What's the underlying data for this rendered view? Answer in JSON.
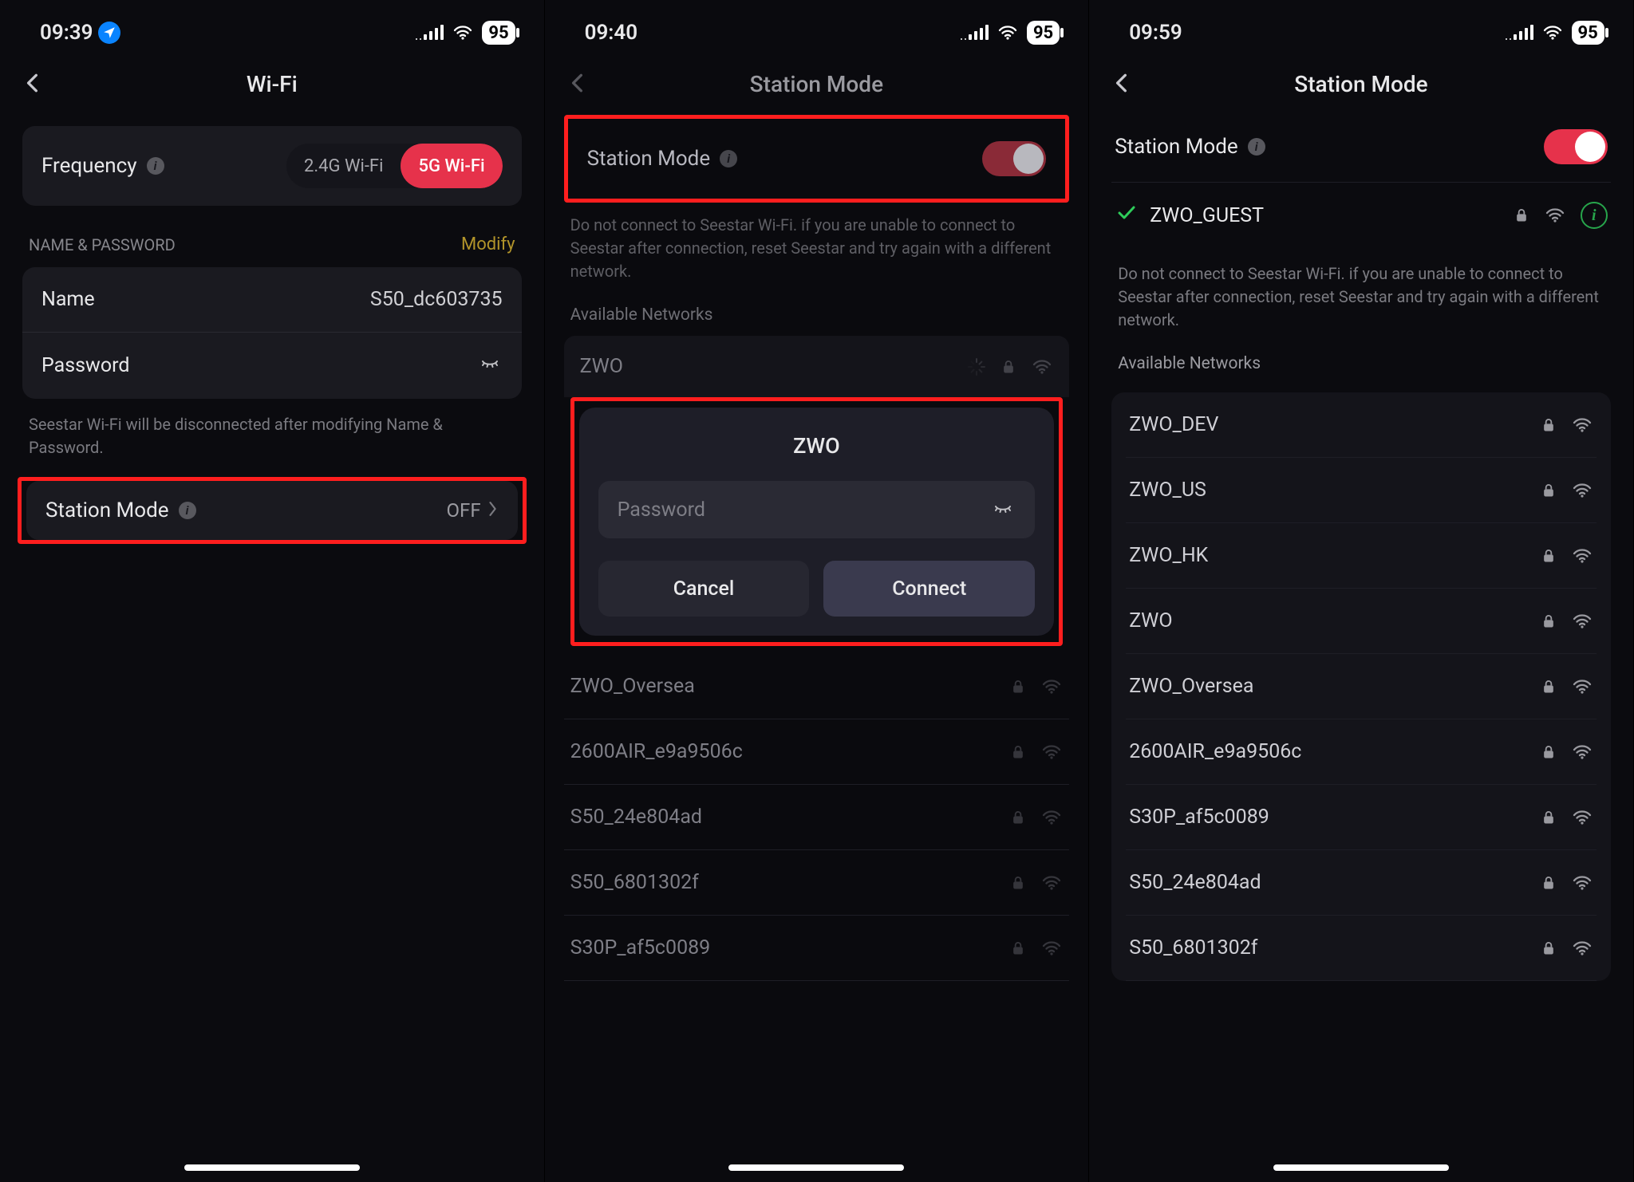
{
  "panel1": {
    "status": {
      "time": "09:39",
      "battery": "95"
    },
    "title": "Wi-Fi",
    "frequency": {
      "label": "Frequency",
      "option_a": "2.4G Wi-Fi",
      "option_b": "5G Wi-Fi"
    },
    "name_password": {
      "header": "NAME & PASSWORD",
      "modify": "Modify",
      "name_label": "Name",
      "name_value": "S50_dc603735",
      "password_label": "Password",
      "help": "Seestar Wi-Fi will be disconnected after modifying Name & Password."
    },
    "station_mode": {
      "label": "Station Mode",
      "value": "OFF"
    }
  },
  "panel2": {
    "status": {
      "time": "09:40",
      "battery": "95"
    },
    "title": "Station Mode",
    "station_mode_label": "Station Mode",
    "help": "Do not connect to Seestar Wi-Fi. if you are unable to connect to Seestar after connection, reset Seestar and try again with a different network.",
    "available_label": "Available Networks",
    "connecting_network": "ZWO",
    "modal": {
      "title": "ZWO",
      "password_placeholder": "Password",
      "cancel": "Cancel",
      "connect": "Connect"
    },
    "networks": [
      "ZWO_Oversea",
      "2600AIR_e9a9506c",
      "S50_24e804ad",
      "S50_6801302f",
      "S30P_af5c0089"
    ]
  },
  "panel3": {
    "status": {
      "time": "09:59",
      "battery": "95"
    },
    "title": "Station Mode",
    "station_mode_label": "Station Mode",
    "connected_network": "ZWO_GUEST",
    "help": "Do not connect to Seestar Wi-Fi. if you are unable to connect to Seestar after connection, reset Seestar and try again with a different network.",
    "available_label": "Available Networks",
    "networks": [
      "ZWO_DEV",
      "ZWO_US",
      "ZWO_HK",
      "ZWO",
      "ZWO_Oversea",
      "2600AIR_e9a9506c",
      "S30P_af5c0089",
      "S50_24e804ad",
      "S50_6801302f"
    ]
  }
}
